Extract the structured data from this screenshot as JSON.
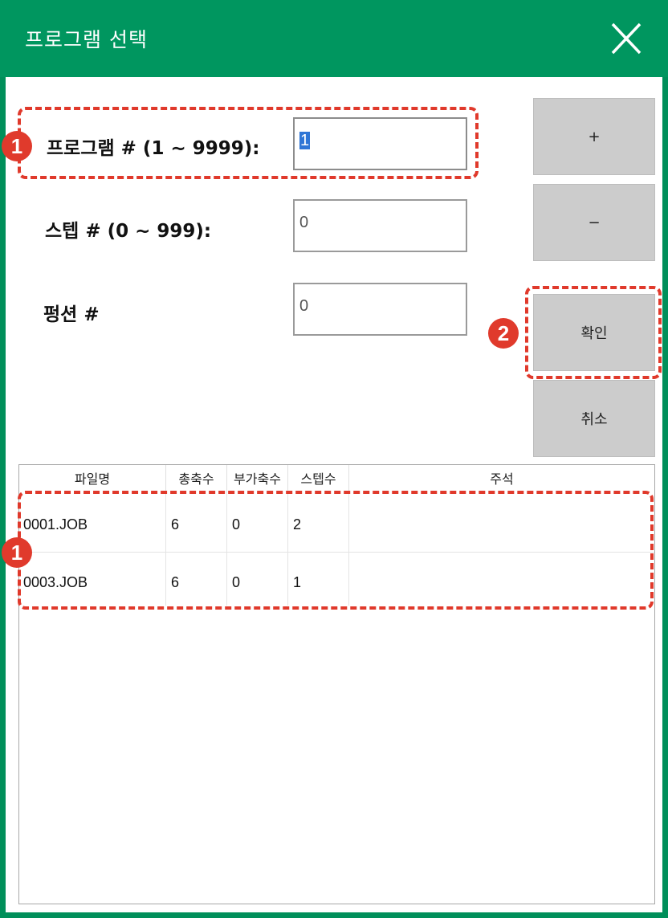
{
  "window": {
    "title": "프로그램 선택",
    "close_icon": "close-icon"
  },
  "fields": {
    "program_label": "프로그램 # (1 ~ 9999):",
    "program_value": "1",
    "step_label": "스텝 # (0 ~ 999):",
    "step_value": "0",
    "function_label": "펑션 #",
    "function_value": "0"
  },
  "buttons": {
    "plus": "+",
    "minus": "−",
    "ok": "확인",
    "cancel": "취소"
  },
  "table": {
    "headers": [
      "파일명",
      "총축수",
      "부가축수",
      "스텝수",
      "주석"
    ],
    "rows": [
      [
        "0001.JOB",
        "6",
        "0",
        "2",
        ""
      ],
      [
        "0003.JOB",
        "6",
        "0",
        "1",
        ""
      ]
    ]
  },
  "annotations": {
    "badge_1": "1",
    "badge_2": "2",
    "badge_1b": "1",
    "color": "#e0392b"
  },
  "colors": {
    "titlebar": "#00965f",
    "button": "#cccccc",
    "selection": "#2f76d6"
  }
}
